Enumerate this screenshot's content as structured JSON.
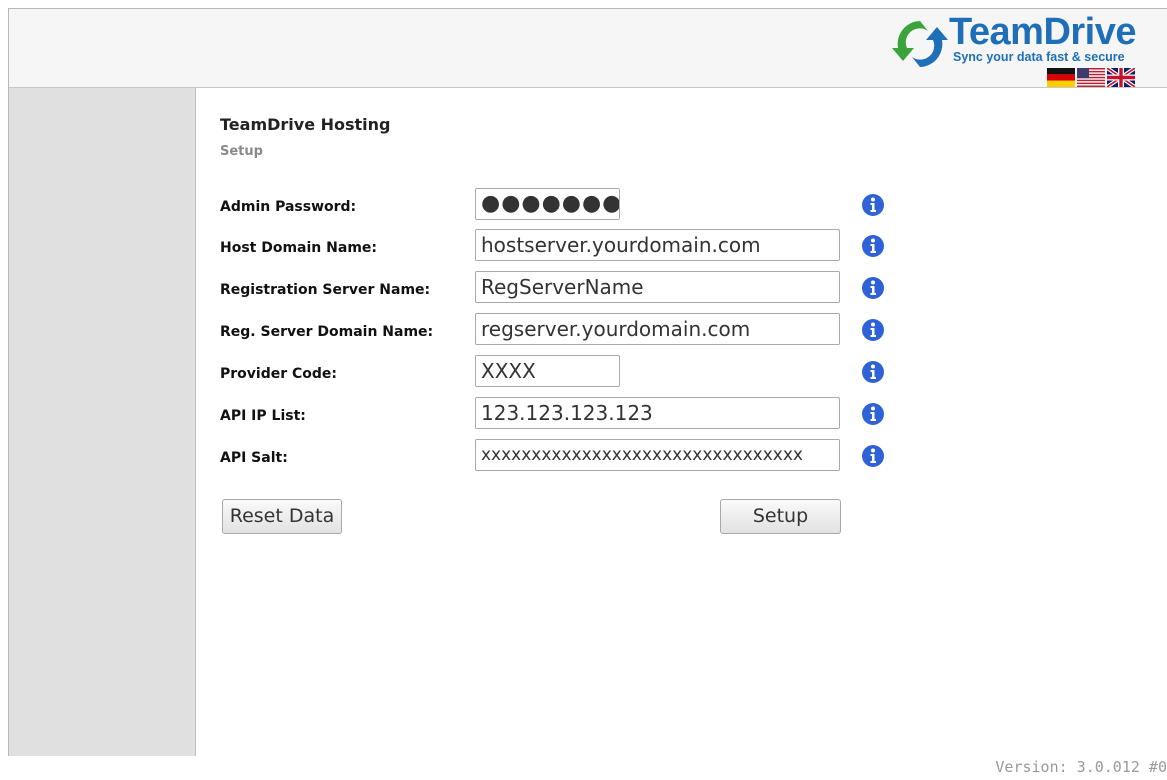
{
  "brand": {
    "name": "TeamDrive",
    "tagline": "Sync your data fast & secure",
    "languages": [
      "de-flag",
      "us-flag",
      "uk-flag"
    ]
  },
  "page": {
    "title": "TeamDrive Hosting",
    "subtitle": "Setup"
  },
  "form": {
    "admin_password": {
      "label": "Admin Password:",
      "value": "●●●●●●●"
    },
    "host_domain": {
      "label": "Host Domain Name:",
      "value": "hostserver.yourdomain.com"
    },
    "reg_server_name": {
      "label": "Registration Server Name:",
      "value": "RegServerName"
    },
    "reg_server_domain": {
      "label": "Reg. Server Domain Name:",
      "value": "regserver.yourdomain.com"
    },
    "provider_code": {
      "label": "Provider Code:",
      "value": "XXXX"
    },
    "api_ip_list": {
      "label": "API IP List:",
      "value": "123.123.123.123"
    },
    "api_salt": {
      "label": "API Salt:",
      "value": "xxxxxxxxxxxxxxxxxxxxxxxxxxxxxxxx"
    }
  },
  "buttons": {
    "reset": "Reset Data",
    "setup": "Setup"
  },
  "footer": {
    "version": "Version: 3.0.012 #0"
  },
  "colors": {
    "brand_blue": "#1f6fb8",
    "brand_green": "#3aa33a",
    "info_blue": "#2f62d6",
    "sidebar": "#e0e0e0"
  }
}
